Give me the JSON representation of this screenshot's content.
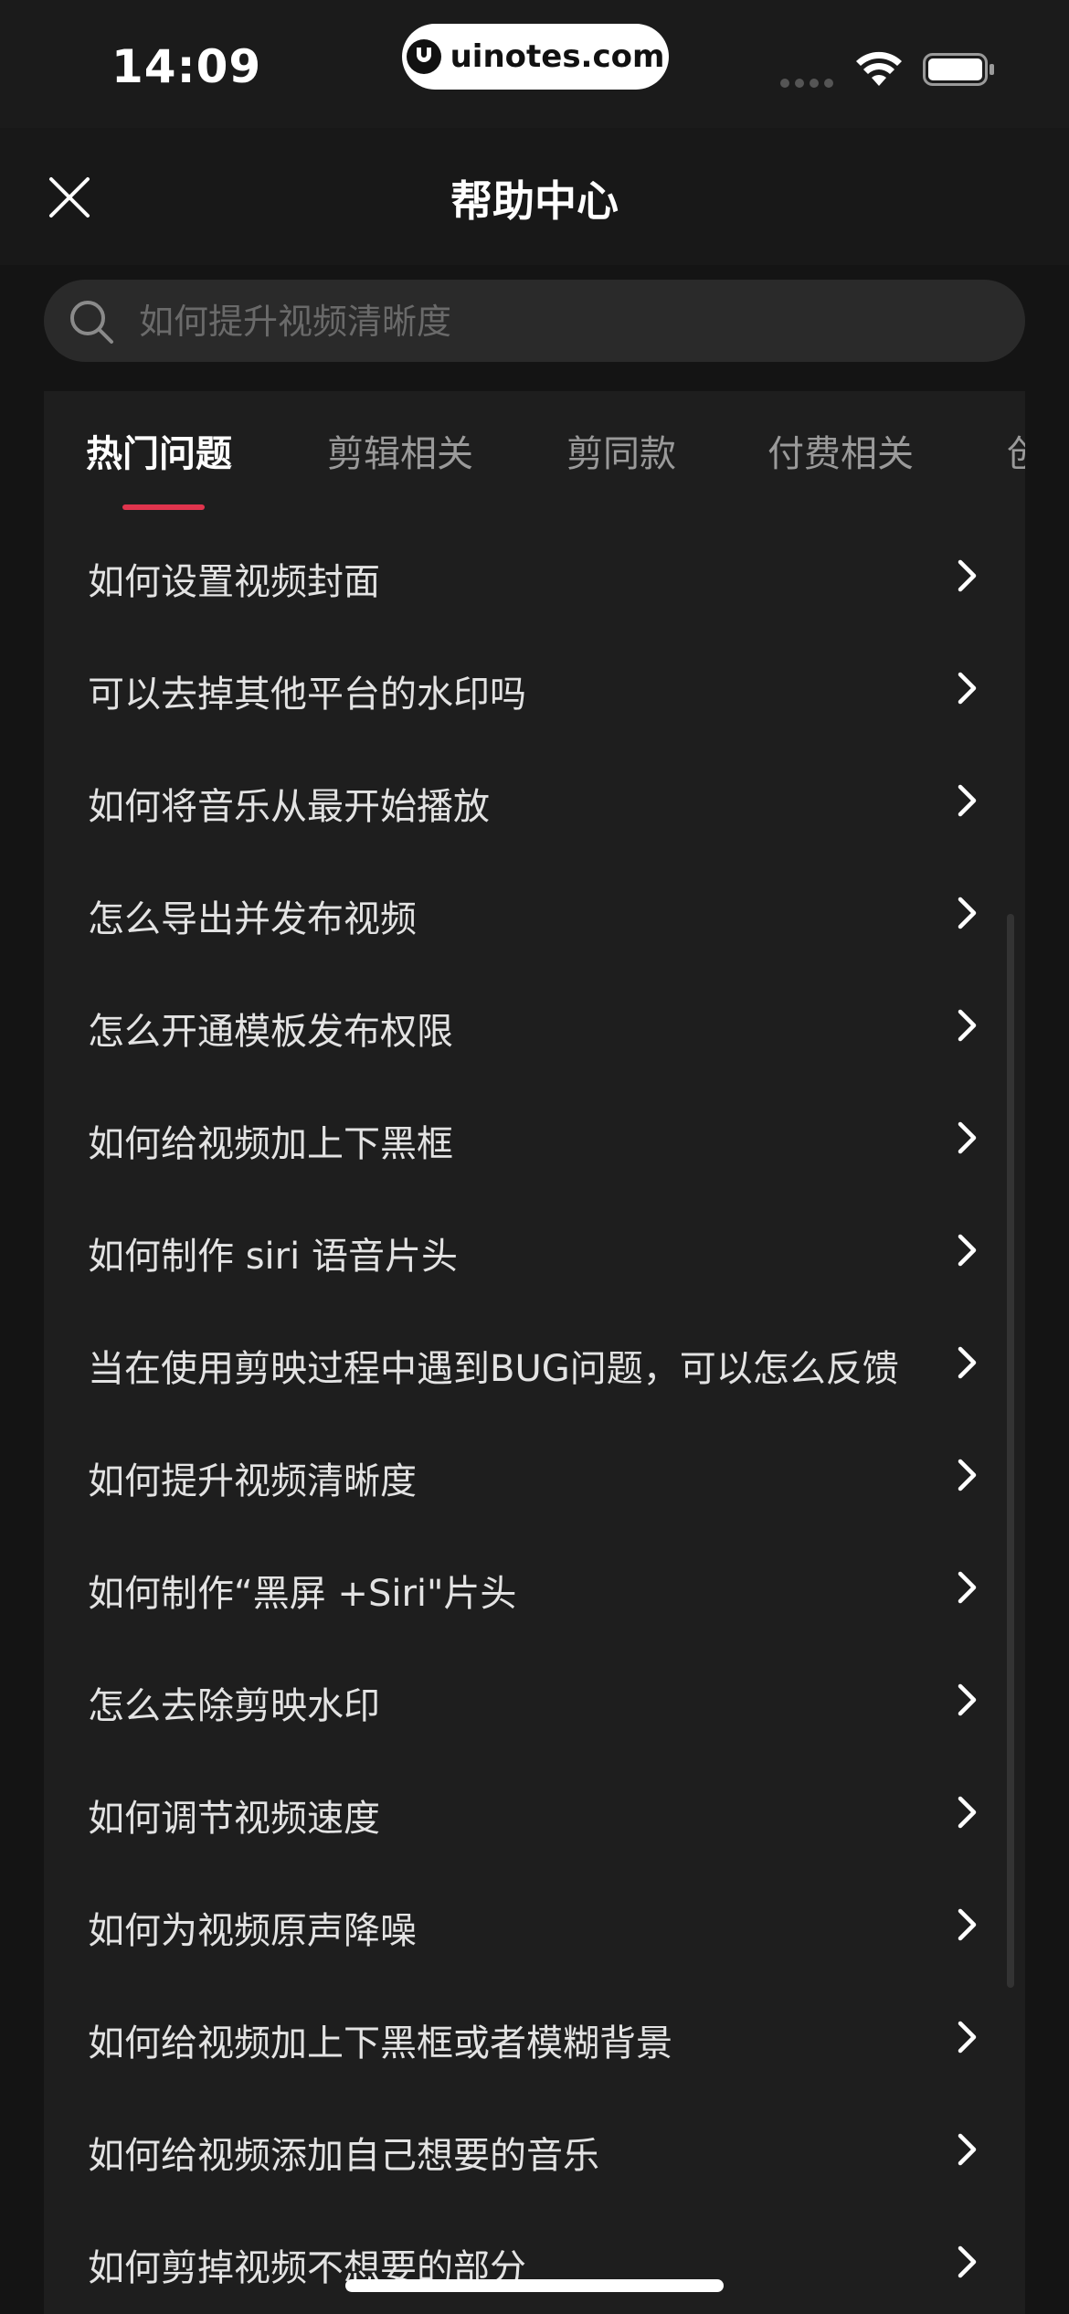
{
  "status_bar": {
    "time": "14:09",
    "watermark": "uinotes.com",
    "icons": [
      "cellular-signal-icon",
      "wifi-icon",
      "battery-icon"
    ]
  },
  "header": {
    "title": "帮助中心",
    "close_icon": "close-icon"
  },
  "search": {
    "placeholder": "如何提升视频清晰度",
    "value": "",
    "icon": "search-icon"
  },
  "tabs": [
    {
      "label": "热门问题",
      "active": true
    },
    {
      "label": "剪辑相关",
      "active": false
    },
    {
      "label": "剪同款",
      "active": false
    },
    {
      "label": "付费相关",
      "active": false
    },
    {
      "label": "创",
      "active": false
    }
  ],
  "faq": [
    "如何设置视频封面",
    "可以去掉其他平台的水印吗",
    "如何将音乐从最开始播放",
    "怎么导出并发布视频",
    "怎么开通模板发布权限",
    "如何给视频加上下黑框",
    "如何制作 siri 语音片头",
    "当在使用剪映过程中遇到BUG问题，可以怎么反馈",
    "如何提升视频清晰度",
    "如何制作“黑屏 +Siri\"片头",
    "怎么去除剪映水印",
    "如何调节视频速度",
    "如何为视频原声降噪",
    "如何给视频加上下黑框或者模糊背景",
    "如何给视频添加自己想要的音乐",
    "如何剪掉视频不想要的部分"
  ],
  "colors": {
    "background": "#141414",
    "panel": "#1e1e1e",
    "search_bg": "#2a2a2a",
    "accent": "#e0344d",
    "text_primary": "#ffffff",
    "text_secondary": "#9a9a9a"
  }
}
